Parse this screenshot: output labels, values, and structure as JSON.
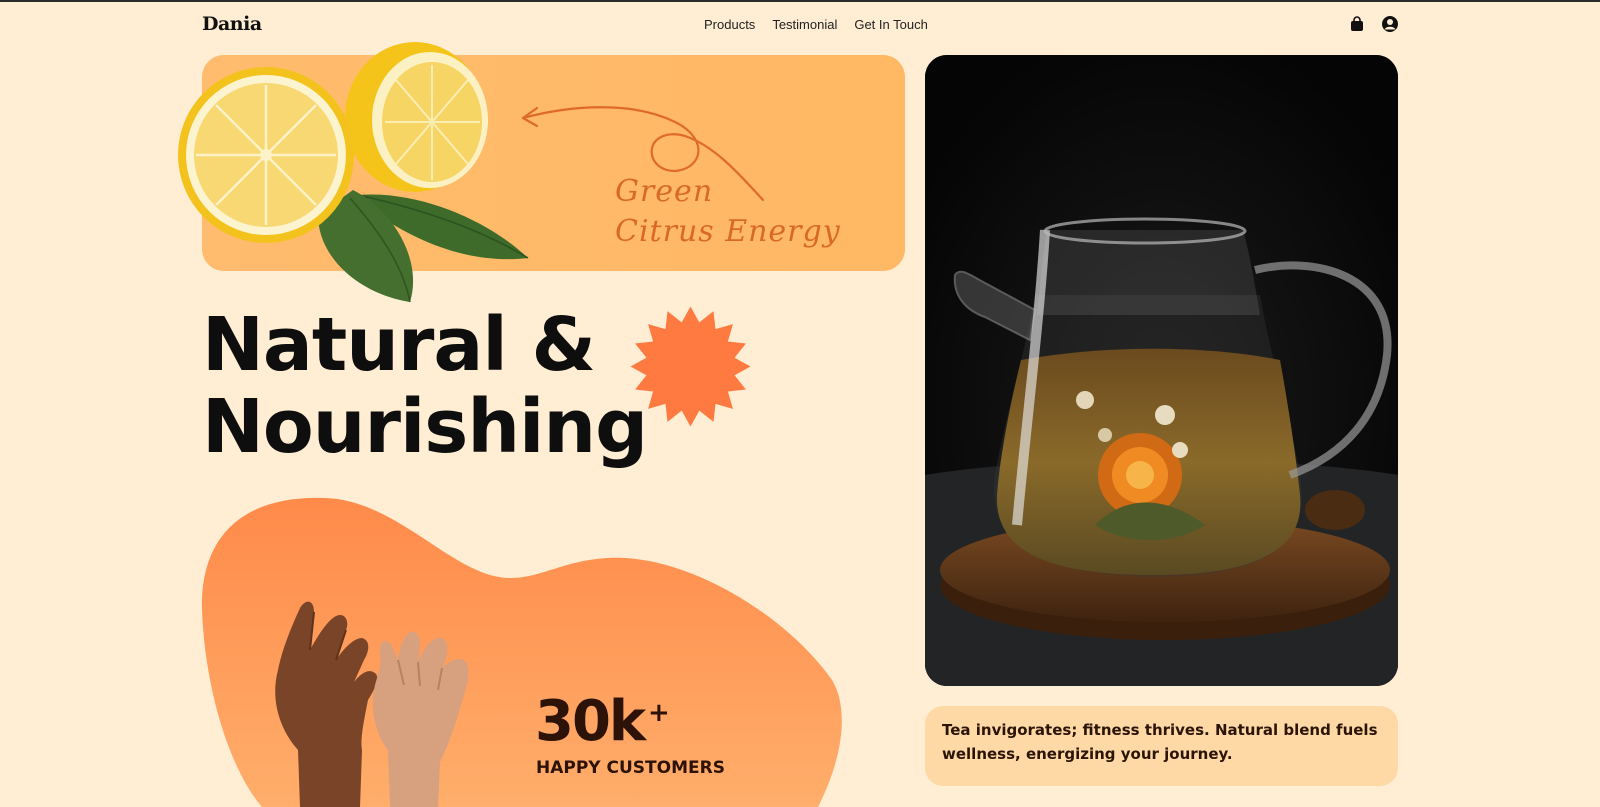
{
  "header": {
    "logo": "Dania",
    "nav": [
      {
        "label": "Products"
      },
      {
        "label": "Testimonial"
      },
      {
        "label": "Get In Touch"
      }
    ],
    "icons": [
      "shopping-bag-icon",
      "user-account-icon"
    ]
  },
  "banner": {
    "line1": "Green",
    "line2": "Citrus Energy"
  },
  "hero": {
    "line1": "Natural &",
    "line2": "Nourishing"
  },
  "stats": {
    "number": "30k",
    "plus": "+",
    "label": "HAPPY CUSTOMERS"
  },
  "quote": {
    "text": "Tea invigorates; fitness thrives. Natural blend fuels wellness, energizing your journey."
  },
  "colors": {
    "background": "#ffeed3",
    "banner": "#ffbb6e",
    "accent": "#ff7a40",
    "text": "#0e0e0e",
    "quote_bg": "#ffd9a5"
  }
}
